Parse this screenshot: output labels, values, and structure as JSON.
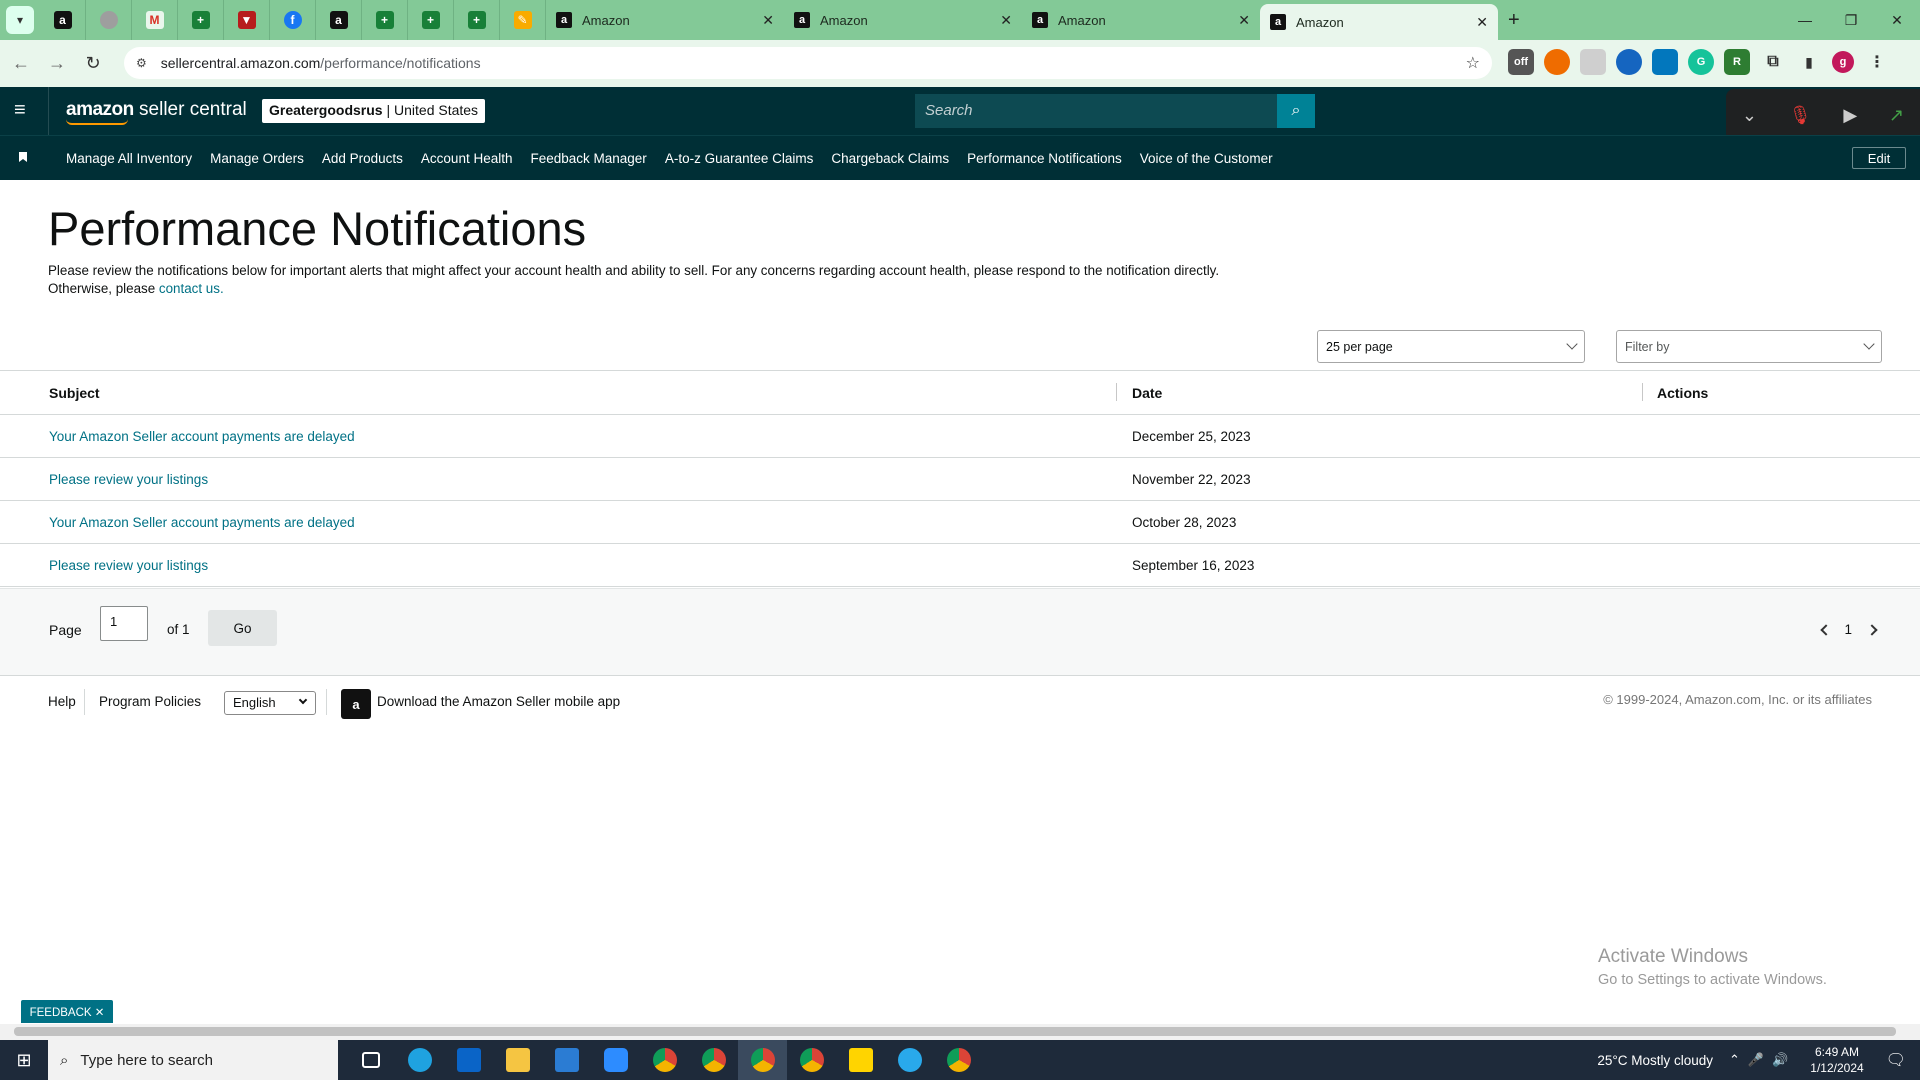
{
  "browser": {
    "tabs": [
      {
        "title": "Amazon"
      },
      {
        "title": "Amazon"
      },
      {
        "title": "Amazon"
      },
      {
        "title": "Amazon"
      }
    ],
    "url_host": "sellercentral.amazon.com",
    "url_path": "/performance/notifications"
  },
  "header": {
    "logo_text_bold": "amazon",
    "logo_text": " seller central",
    "store_name": "Greatergoodsrus",
    "store_region": " | United States",
    "search_placeholder": "Search"
  },
  "nav": {
    "items": [
      "Manage All Inventory",
      "Manage Orders",
      "Add Products",
      "Account Health",
      "Feedback Manager",
      "A-to-z Guarantee Claims",
      "Chargeback Claims",
      "Performance Notifications",
      "Voice of the Customer"
    ],
    "edit_label": "Edit"
  },
  "page": {
    "title": "Performance Notifications",
    "intro_text": "Please review the notifications below for important alerts that might affect your account health and ability to sell. For any concerns regarding account health, please respond to the notification directly. Otherwise, please ",
    "intro_link": "contact us."
  },
  "controls": {
    "per_page": "25 per page",
    "filter_placeholder": "Filter by"
  },
  "table": {
    "headers": {
      "subject": "Subject",
      "date": "Date",
      "actions": "Actions"
    },
    "rows": [
      {
        "subject": "Your Amazon Seller account payments are delayed",
        "date": "December 25, 2023"
      },
      {
        "subject": "Please review your listings",
        "date": "November 22, 2023"
      },
      {
        "subject": "Your Amazon Seller account payments are delayed",
        "date": "October 28, 2023"
      },
      {
        "subject": "Please review your listings",
        "date": "September 16, 2023"
      }
    ]
  },
  "pagination": {
    "page_label": "Page",
    "page_value": "1",
    "of_label": "of 1",
    "go_label": "Go",
    "current_page": "1"
  },
  "footer": {
    "help": "Help",
    "program_policies": "Program Policies",
    "language": "English",
    "app_link": "Download the Amazon Seller mobile app",
    "copyright": "© 1999-2024, Amazon.com, Inc. or its affiliates"
  },
  "watermark": {
    "line1": "Activate Windows",
    "line2": "Go to Settings to activate Windows."
  },
  "feedback_label": "FEEDBACK ✕",
  "taskbar": {
    "search_placeholder": "Type here to search",
    "weather": "25°C  Mostly cloudy",
    "time": "6:49 AM",
    "date": "1/12/2024"
  },
  "colors": {
    "header_bg": "#002f36",
    "link": "#007185",
    "tabbar_bg": "#83c997",
    "search_button": "#008296"
  }
}
